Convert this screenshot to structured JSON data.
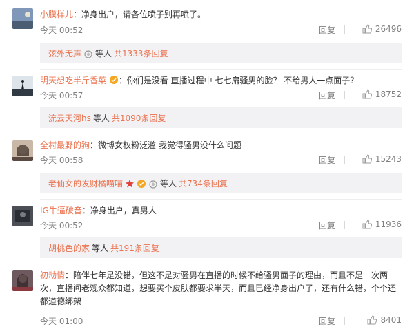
{
  "comments": [
    {
      "username": "小膜样儿",
      "sep": "：",
      "text": "净身出户，请各位喷子别再喷了。",
      "time": "今天 00:52",
      "reply_label": "回复",
      "likes": "26496",
      "sub": {
        "user": "弦外无声",
        "mid": "等人",
        "count": "共1333条回复"
      }
    },
    {
      "username": "明天想吃半斤香菜",
      "sep": "：",
      "text": "你们是没看 直播过程中 七七扇骚男的脸？ 不给男人一点面子？",
      "time": "今天 00:57",
      "reply_label": "回复",
      "likes": "18752",
      "sub": {
        "user": "流云天河hs",
        "mid": "等人",
        "count": "共1090条回复"
      }
    },
    {
      "username": "全村最野的狗",
      "sep": "：",
      "text": "微博女权粉泛滥 我觉得骚男没什么问题",
      "time": "今天 00:58",
      "reply_label": "回复",
      "likes": "15243",
      "sub": {
        "user": "老仙女的发财橘喵喵",
        "mid": "等人",
        "count": "共734条回复"
      }
    },
    {
      "username": "IG牛逼破音",
      "sep": "：",
      "text": "净身出户，真男人",
      "time": "今天 00:52",
      "reply_label": "回复",
      "likes": "11936",
      "sub": {
        "user": "胡桃色的家",
        "mid": "等人",
        "count": "共191条回复"
      }
    },
    {
      "username": "初动情",
      "sep": "：",
      "text": "陪伴七年是没错，但这不是对骚男在直播的时候不给骚男面子的理由，而且不是一次两次，直播间老观众都知道，想要买个皮肤都要求半天，而且已经净身出户了，还有什么错，个个还都道德绑架",
      "time": "今天 01:00",
      "reply_label": "回复",
      "likes": "8401"
    }
  ],
  "colors": {
    "accent": "#eb7350",
    "meta": "#808080",
    "sub_bg": "#f2f2f5"
  }
}
